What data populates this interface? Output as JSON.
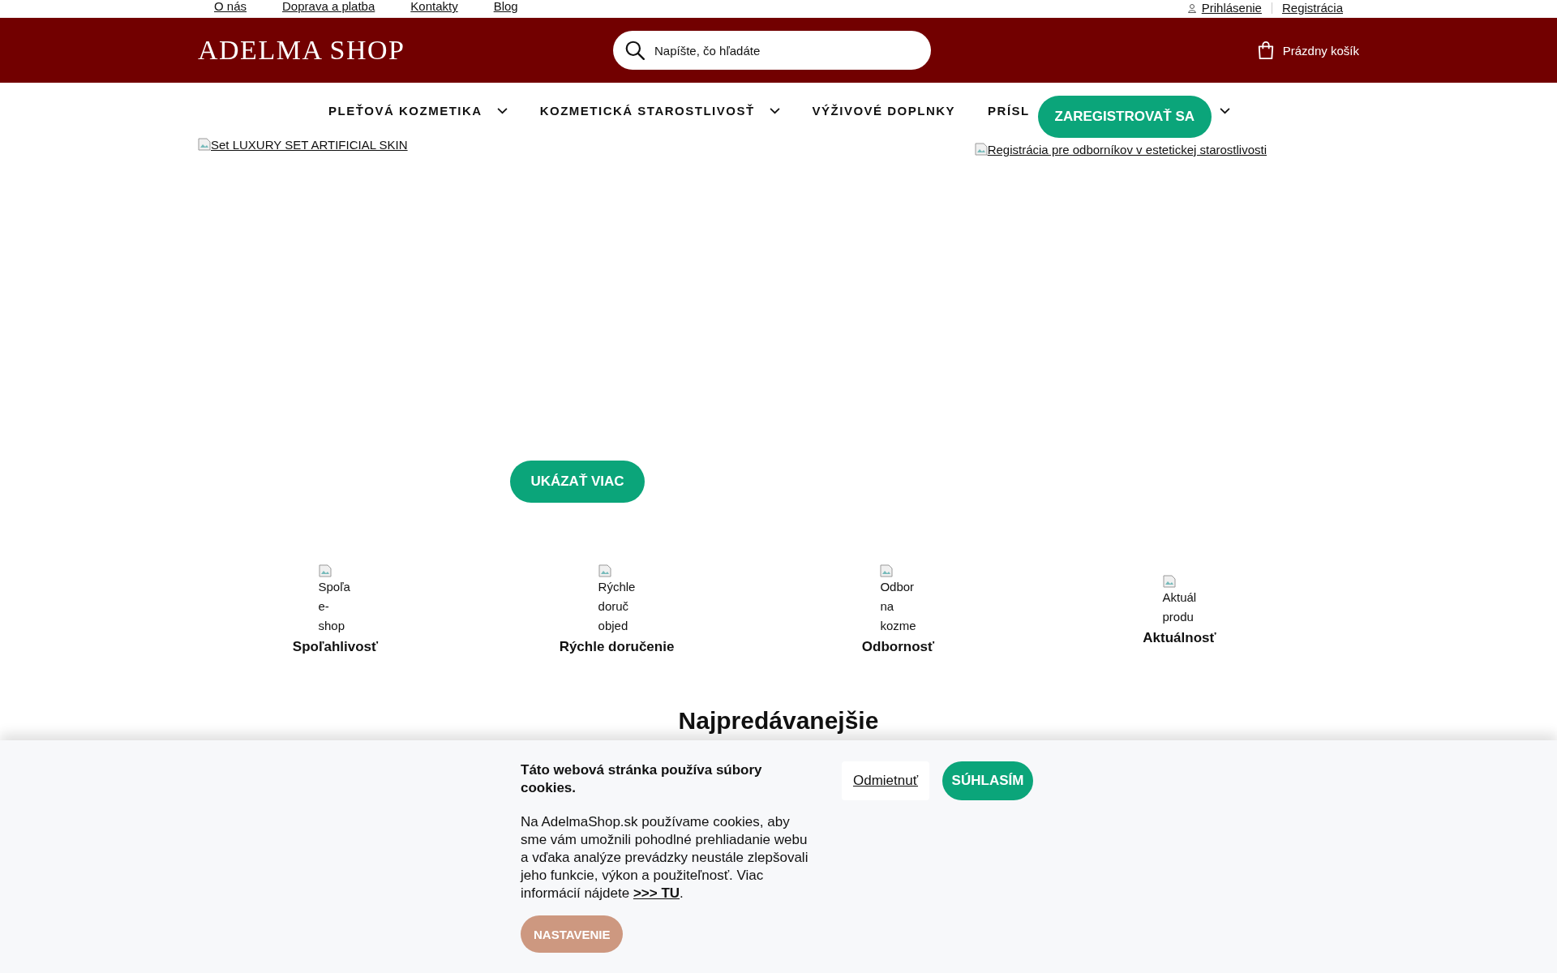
{
  "top_links": [
    "O nás",
    "Doprava a platba",
    "Kontakty",
    "Blog"
  ],
  "account_links": [
    {
      "kind": "login",
      "label": "Prihlásenie"
    },
    {
      "kind": "plain",
      "label": "Registrácia"
    }
  ],
  "header": {
    "logo": "ADELMA SHOP",
    "search": {
      "placeholder": "Napíšte, čo hľadáte"
    },
    "cart": "Prázdny košík"
  },
  "nav": [
    {
      "label": "PLEŤOVÁ KOZMETIKA",
      "dropdown": true
    },
    {
      "label": "KOZMETICKÁ STAROSTLIVOSŤ",
      "dropdown": true
    },
    {
      "label": "VÝŽIVOVÉ DOPLNKY",
      "dropdown": false
    },
    {
      "label": "PRÍSL",
      "dropdown": true
    }
  ],
  "register_button": "ZAREGISTROVAŤ SA",
  "banners": [
    {
      "alt": "Set LUXURY SET ARTIFICIAL SKIN"
    },
    {
      "alt": "Registrácia pre odborníkov v estetickej starostlivosti"
    }
  ],
  "show_more": "UKÁZAŤ VIAC",
  "features": [
    {
      "alt_lines": [
        "Spoľa",
        "e-",
        "shop"
      ],
      "title": "Spoľahlivosť"
    },
    {
      "alt_lines": [
        "Rýchle",
        "doruč",
        "objed"
      ],
      "title": "Rýchle doručenie"
    },
    {
      "alt_lines": [
        "Odbor",
        "na",
        "kozme"
      ],
      "title": "Odbornosť"
    },
    {
      "alt_lines": [
        "Aktuál",
        "produ"
      ],
      "title": "Aktuálnosť"
    }
  ],
  "section_title": "Najpredávanejšie",
  "cookies": {
    "title": "Táto webová stránka používa súbory cookies.",
    "text": "Na AdelmaShop.sk používame cookies, aby sme vám umožnili pohodlné prehliadanie webu a vďaka analýze prevádzky neustále zlepšovali jeho funkcie, výkon a použiteľnosť. Viac informácií nájdete",
    "link": ">>> TU",
    "after_link": ".",
    "settings": "NASTAVENIE",
    "reject": "Odmietnuť",
    "accept": "SÚHLASÍM"
  }
}
